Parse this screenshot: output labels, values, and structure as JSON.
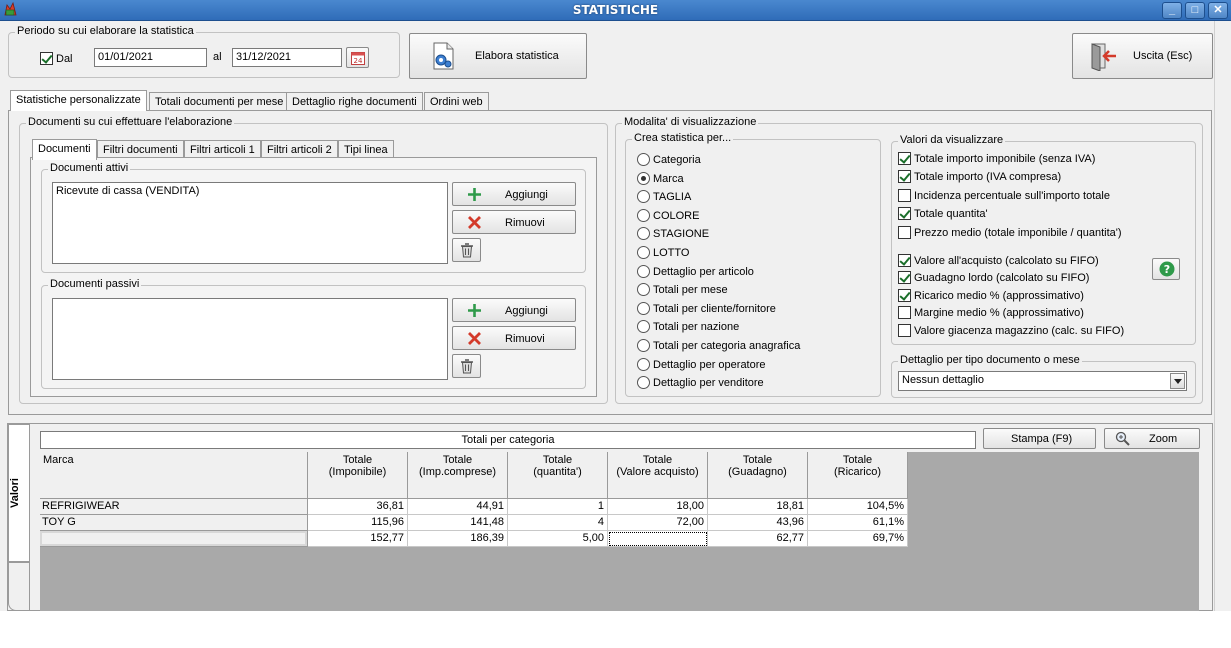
{
  "window": {
    "title": "STATISTICHE",
    "controls": [
      "_",
      "□",
      "✕"
    ]
  },
  "period": {
    "group_label": "Periodo su cui elaborare la statistica",
    "dal_checked": true,
    "dal_label": "Dal",
    "date_from": "01/01/2021",
    "al_label": "al",
    "date_to": "31/12/2021",
    "calendar_day": "24"
  },
  "buttons": {
    "elabora": "Elabora statistica",
    "uscita": "Uscita (Esc)"
  },
  "main_tabs": [
    {
      "label": "Statistiche personalizzate",
      "active": true
    },
    {
      "label": "Totali documenti per mese",
      "active": false
    },
    {
      "label": "Dettaglio righe documenti",
      "active": false
    },
    {
      "label": "Ordini web",
      "active": false
    }
  ],
  "documents_group": {
    "label": "Documenti su cui effettuare l'elaborazione",
    "tabs": [
      {
        "label": "Documenti",
        "active": true
      },
      {
        "label": "Filtri documenti",
        "active": false
      },
      {
        "label": "Filtri articoli 1",
        "active": false
      },
      {
        "label": "Filtri articoli 2",
        "active": false
      },
      {
        "label": "Tipi linea",
        "active": false
      }
    ],
    "attivi": {
      "label": "Documenti attivi",
      "items": [
        "Ricevute di cassa (VENDITA)"
      ],
      "add_label": "Aggiungi",
      "remove_label": "Rimuovi"
    },
    "passivi": {
      "label": "Documenti passivi",
      "items": [],
      "add_label": "Aggiungi",
      "remove_label": "Rimuovi"
    }
  },
  "view_mode": {
    "label": "Modalita' di visualizzazione",
    "crea": {
      "label": "Crea statistica per...",
      "options": [
        {
          "label": "Categoria",
          "selected": false
        },
        {
          "label": "Marca",
          "selected": true
        },
        {
          "label": "TAGLIA",
          "selected": false
        },
        {
          "label": "COLORE",
          "selected": false
        },
        {
          "label": "STAGIONE",
          "selected": false
        },
        {
          "label": "LOTTO",
          "selected": false
        },
        {
          "label": "Dettaglio per articolo",
          "selected": false
        },
        {
          "label": "Totali per mese",
          "selected": false
        },
        {
          "label": "Totali per cliente/fornitore",
          "selected": false
        },
        {
          "label": "Totali per nazione",
          "selected": false
        },
        {
          "label": "Totali per categoria anagrafica",
          "selected": false
        },
        {
          "label": "Dettaglio per operatore",
          "selected": false
        },
        {
          "label": "Dettaglio per venditore",
          "selected": false
        }
      ]
    },
    "valori": {
      "label": "Valori da visualizzare",
      "checks": [
        {
          "label": "Totale importo imponibile (senza IVA)",
          "checked": true
        },
        {
          "label": "Totale importo (IVA compresa)",
          "checked": true
        },
        {
          "label": "Incidenza percentuale sull'importo totale",
          "checked": false
        },
        {
          "label": "Totale quantita'",
          "checked": true
        },
        {
          "label": "Prezzo medio (totale imponibile / quantita')",
          "checked": false
        },
        {
          "label": "Valore all'acquisto (calcolato su FIFO)",
          "checked": true
        },
        {
          "label": "Guadagno lordo (calcolato su FIFO)",
          "checked": true
        },
        {
          "label": "Ricarico medio % (approssimativo)",
          "checked": true
        },
        {
          "label": "Margine medio % (approssimativo)",
          "checked": false
        },
        {
          "label": "Valore giacenza magazzino (calc. su FIFO)",
          "checked": false
        }
      ]
    },
    "dettaglio": {
      "label": "Dettaglio per tipo documento o mese",
      "selected": "Nessun dettaglio"
    }
  },
  "results": {
    "side_tab": "Valori",
    "title": "Totali per categoria",
    "stampa_label": "Stampa (F9)",
    "zoom_label": "Zoom",
    "columns": [
      {
        "line1": "Marca",
        "line2": ""
      },
      {
        "line1": "Totale",
        "line2": "(Imponibile)"
      },
      {
        "line1": "Totale",
        "line2": "(Imp.comprese)"
      },
      {
        "line1": "Totale",
        "line2": "(quantita')"
      },
      {
        "line1": "Totale",
        "line2": "(Valore acquisto)"
      },
      {
        "line1": "Totale",
        "line2": "(Guadagno)"
      },
      {
        "line1": "Totale",
        "line2": "(Ricarico)"
      }
    ],
    "rows": [
      [
        "REFRIGIWEAR",
        "36,81",
        "44,91",
        "1",
        "18,00",
        "18,81",
        "104,5%"
      ],
      [
        "TOY G",
        "115,96",
        "141,48",
        "4",
        "72,00",
        "43,96",
        "61,1%"
      ],
      [
        "",
        "152,77",
        "186,39",
        "5,00",
        "",
        "62,77",
        "69,7%"
      ]
    ]
  }
}
